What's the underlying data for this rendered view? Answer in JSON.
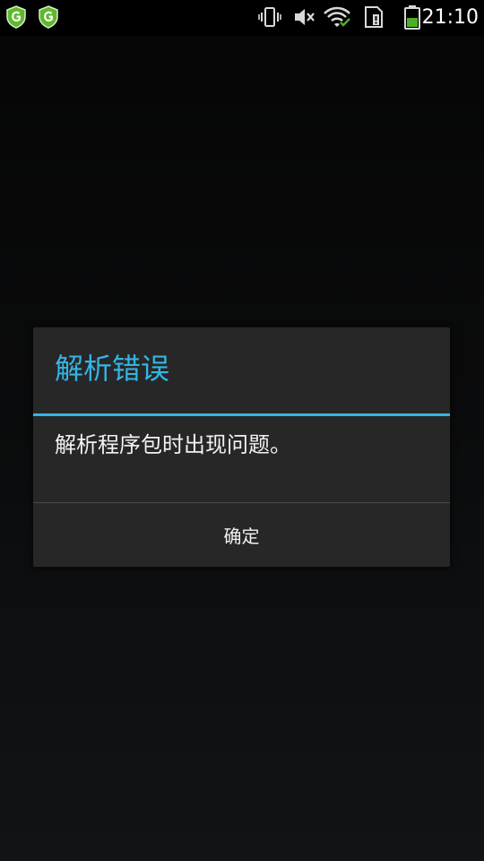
{
  "status_bar": {
    "time": "21:10",
    "icons": [
      "shield-icon",
      "shield-icon",
      "vibrate-icon",
      "volume-mute-icon",
      "wifi-icon",
      "sim-card-icon",
      "battery-icon"
    ],
    "accent_color": "#4caf26"
  },
  "dialog": {
    "title": "解析错误",
    "message": "解析程序包时出现问题。",
    "ok_label": "确定",
    "accent_color": "#33b5e5"
  }
}
